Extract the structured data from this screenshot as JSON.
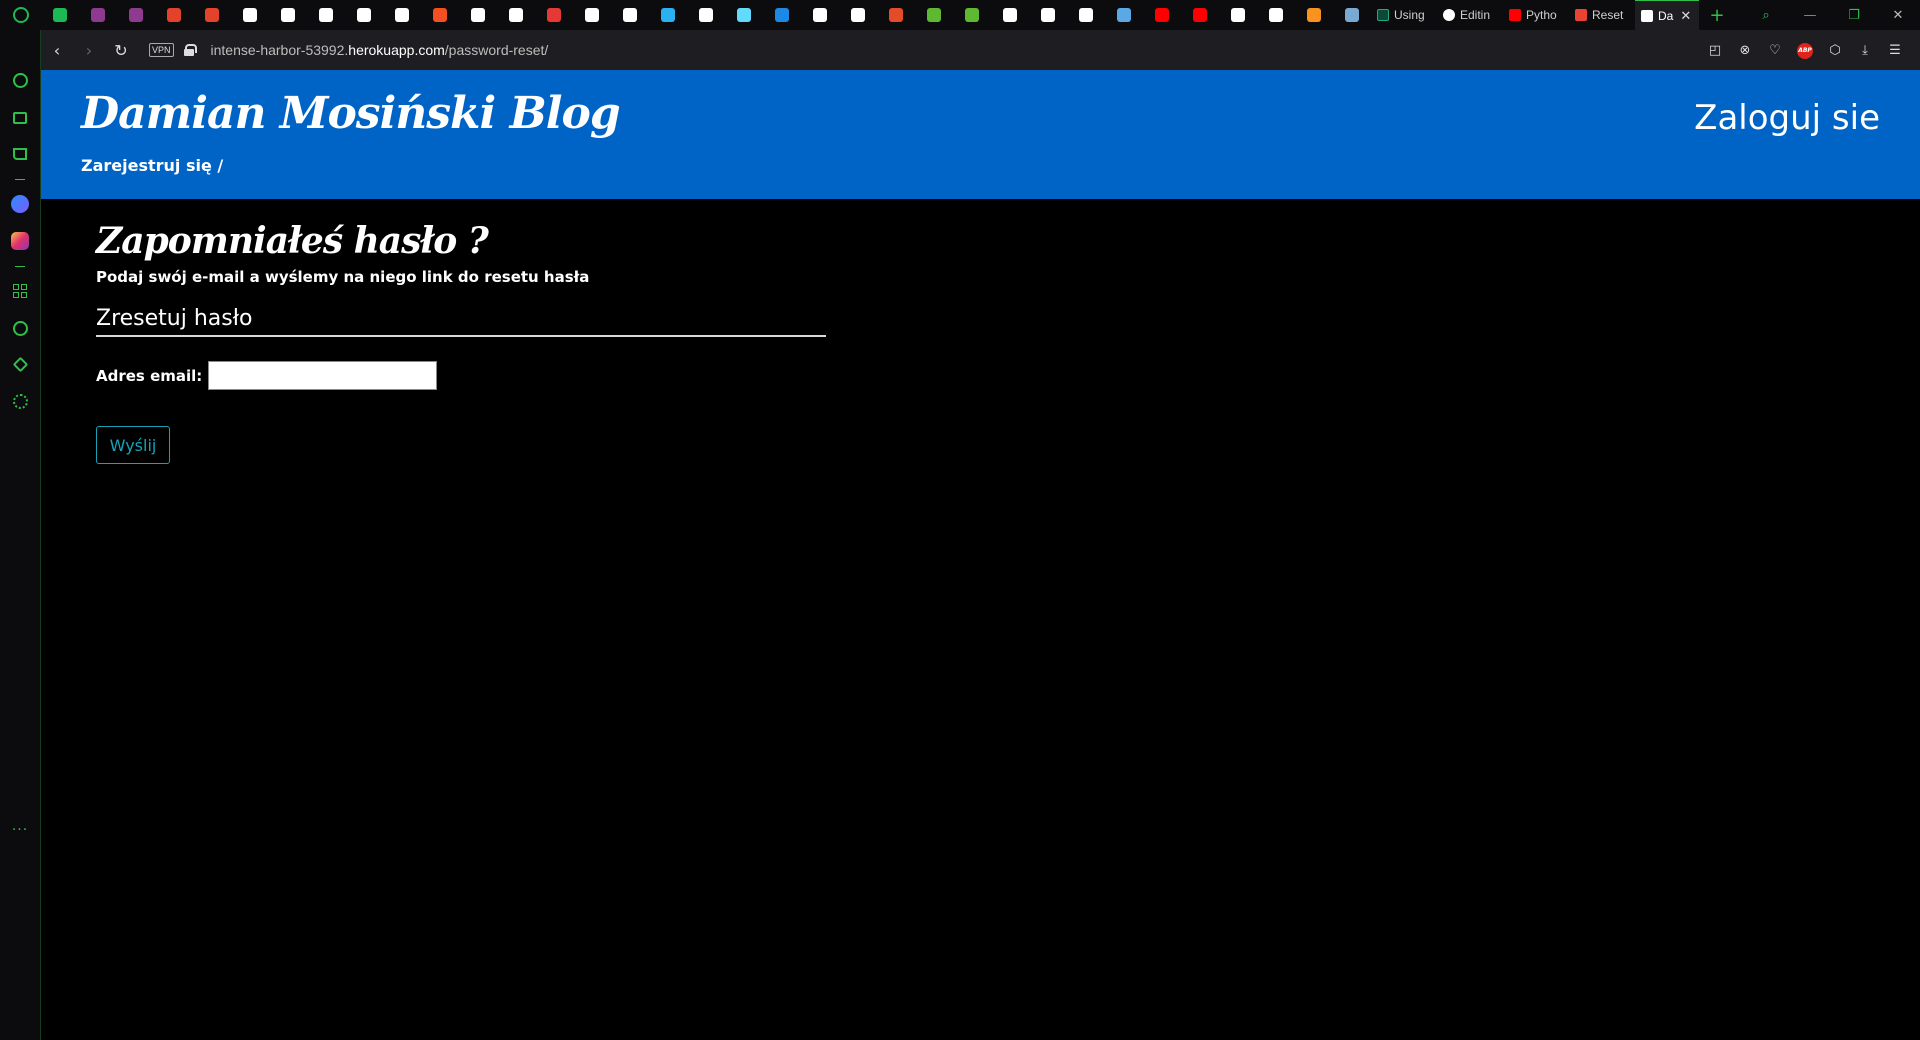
{
  "browser": {
    "tabs": [
      {
        "label": "Using",
        "icon": "django-icon",
        "color": "#0c4b33"
      },
      {
        "label": "Editin",
        "icon": "github-icon",
        "color": "#ffffff"
      },
      {
        "label": "Pytho",
        "icon": "youtube-icon",
        "color": "#ff0000"
      },
      {
        "label": "Reset",
        "icon": "gmail-icon",
        "color": "#ea4335"
      },
      {
        "label": "Da",
        "icon": "document-icon",
        "color": "#ffffff",
        "active": true
      }
    ],
    "pinned_icon_colors": [
      "#1db954",
      "#8e3a8e",
      "#8e3a8e",
      "#e2432a",
      "#e2432a",
      "#ffffff",
      "#ffffff",
      "#ffffff",
      "#ffffff",
      "#ffffff",
      "#f25022",
      "#ffffff",
      "#ffffff",
      "#e53935",
      "#ffffff",
      "#ffffff",
      "#2bb0f0",
      "#ffffff",
      "#61dafb",
      "#1e88e5",
      "#ffffff",
      "#ffffff",
      "#e34c26",
      "#5fb832",
      "#5fb832",
      "#ffffff",
      "#ffffff",
      "#ffffff",
      "#5aa9e6",
      "#ff0000",
      "#ff0000",
      "#ffffff",
      "#ffffff",
      "#f7931e",
      "#7aa9d4"
    ],
    "close_symbol": "✕",
    "new_tab_symbol": "+",
    "address": {
      "vpn_label": "VPN",
      "url_prefix": "intense-harbor-53992.",
      "url_domain": "herokuapp.com",
      "url_path": "/password-reset/"
    },
    "toolbar_right": {
      "abp_label": "ABP"
    }
  },
  "site": {
    "blog_title": "Damian Mosiński Blog",
    "register_link": "Zarejestruj się /",
    "login_link": "Zaloguj sie",
    "header_color": "#0063c6"
  },
  "page": {
    "heading": "Zapomniałeś hasło ?",
    "description": "Podaj swój e-mail a wyślemy na niego link do resetu hasła",
    "form_legend": "Zresetuj hasło",
    "email_label": "Adres email:",
    "email_value": "",
    "submit_label": "Wyślij",
    "submit_color": "#17a2b8"
  }
}
